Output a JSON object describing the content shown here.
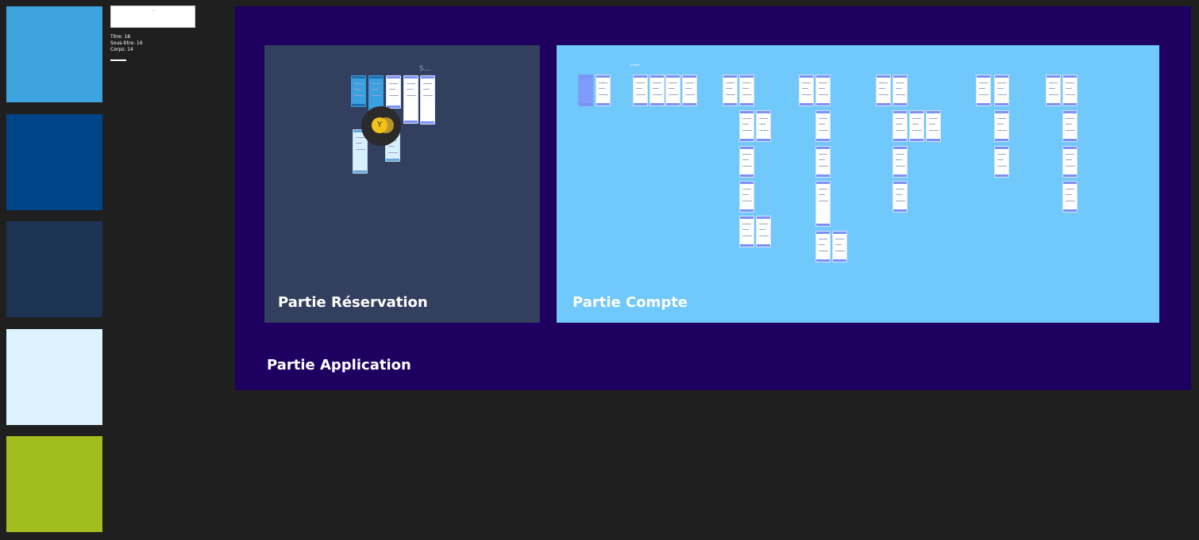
{
  "palette": {
    "swatches": [
      {
        "name": "light-blue",
        "color": "#3ea4e0"
      },
      {
        "name": "dark-blue",
        "color": "#004488"
      },
      {
        "name": "navy",
        "color": "#1c3352"
      },
      {
        "name": "pale-blue",
        "color": "#ddf3ff"
      },
      {
        "name": "lime",
        "color": "#a2bd1e"
      }
    ]
  },
  "typography": {
    "title_line": "Titre: 18",
    "subtitle_line": "Sous-titre: 16",
    "body_line": "Corps: 14"
  },
  "canvas": {
    "app_frame_title": "Partie Application",
    "app_frame_color": "#1e0060",
    "sections": {
      "reservation": {
        "title": "Partie Réservation",
        "color": "#323f5e",
        "ghost_label": "S..."
      },
      "compte": {
        "title": "Partie Compte",
        "color": "#70c8fb",
        "tiny_label": "COMPTE"
      }
    },
    "collaborator": {
      "initial": "Y",
      "color": "#f1c21b"
    }
  }
}
